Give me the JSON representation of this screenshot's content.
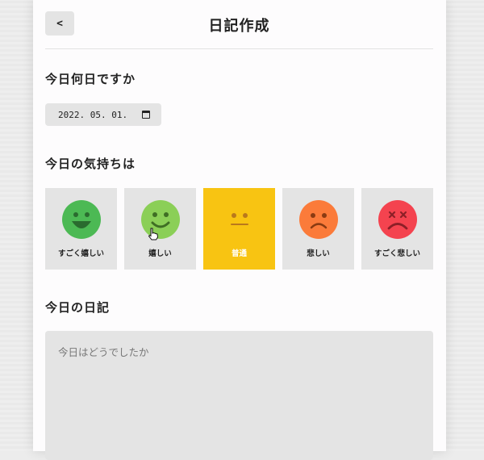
{
  "header": {
    "back_label": "<",
    "title": "日記作成"
  },
  "date_section": {
    "label": "今日何日ですか",
    "value": "2022. 05. 01.",
    "icon": "calendar-icon"
  },
  "mood_section": {
    "label": "今日の気持ちは",
    "selected": 2,
    "options": [
      {
        "label": "すごく嬉しい",
        "color": "#4cb954",
        "icon": "very-happy-face-icon"
      },
      {
        "label": "嬉しい",
        "color": "#8bcf57",
        "icon": "happy-face-icon"
      },
      {
        "label": "普通",
        "color": "#f8c412",
        "icon": "neutral-face-icon"
      },
      {
        "label": "悲しい",
        "color": "#fb7b3a",
        "icon": "sad-face-icon"
      },
      {
        "label": "すごく悲しい",
        "color": "#f4434f",
        "icon": "very-sad-face-icon"
      }
    ]
  },
  "diary_section": {
    "label": "今日の日記",
    "placeholder": "今日はどうでしたか"
  },
  "colors": {
    "selected_bg": "#f8c412",
    "tile_bg": "#e4e4e4",
    "card_bg": "#fdfcfd"
  }
}
